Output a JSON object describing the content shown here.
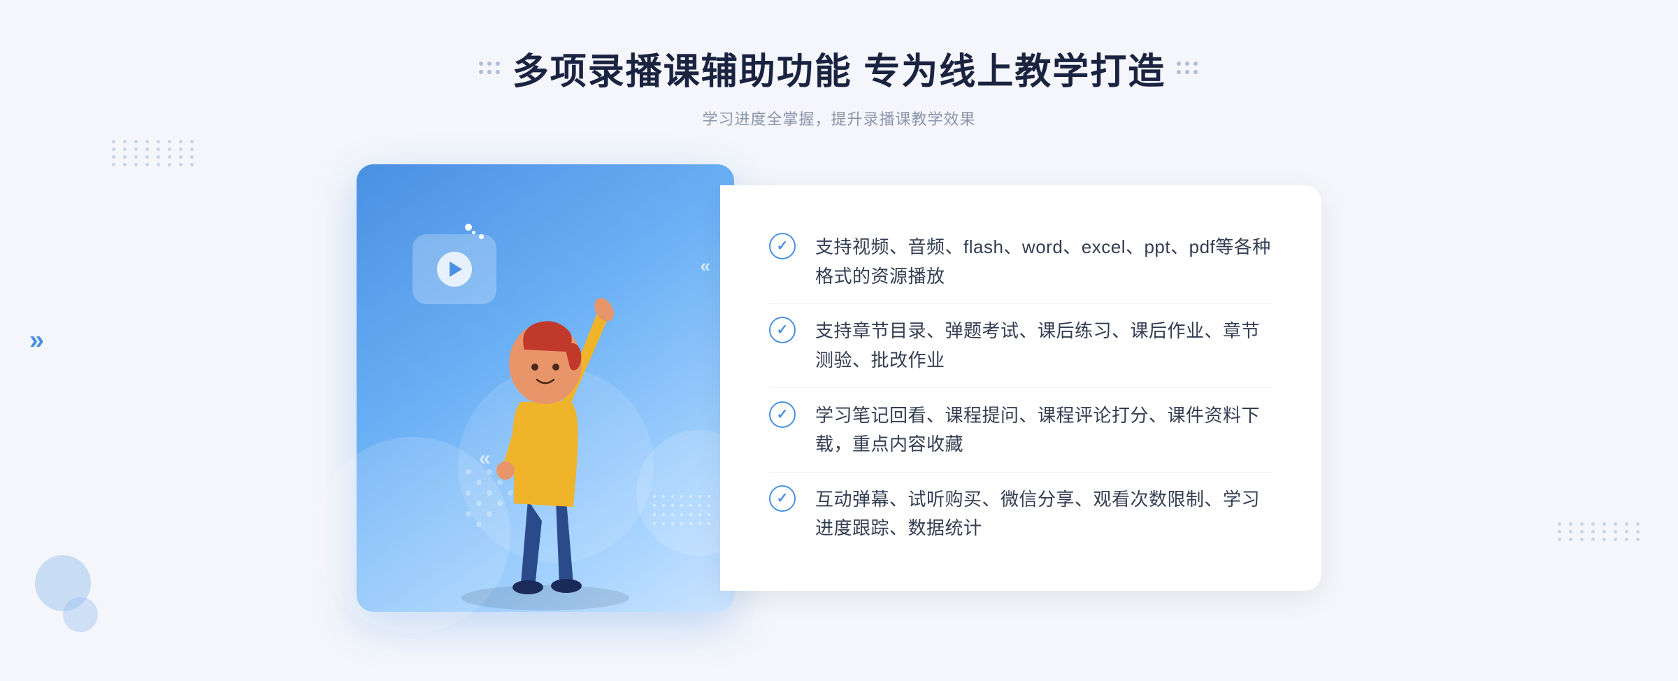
{
  "header": {
    "title": "多项录播课辅助功能 专为线上教学打造",
    "subtitle": "学习进度全掌握，提升录播课教学效果",
    "decorative_dots_left": "❖",
    "decorative_dots_right": "❖"
  },
  "features": [
    {
      "id": "feature-1",
      "text": "支持视频、音频、flash、word、excel、ppt、pdf等各种格式的资源播放"
    },
    {
      "id": "feature-2",
      "text": "支持章节目录、弹题考试、课后练习、课后作业、章节测验、批改作业"
    },
    {
      "id": "feature-3",
      "text": "学习笔记回看、课程提问、课程评论打分、课件资料下载，重点内容收藏"
    },
    {
      "id": "feature-4",
      "text": "互动弹幕、试听购买、微信分享、观看次数限制、学习进度跟踪、数据统计"
    }
  ],
  "check_icon": "✓",
  "left_arrow": "»",
  "colors": {
    "primary": "#4a90e2",
    "title": "#1a2340",
    "subtitle": "#8a94aa",
    "text": "#333d52",
    "bg": "#f4f6fb",
    "card_bg": "#ffffff"
  }
}
